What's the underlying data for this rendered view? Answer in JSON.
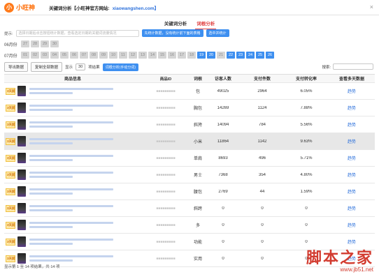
{
  "topbar": {
    "logo_text": "小旺神",
    "logo_glyph": "小",
    "title": "关键词分析【小旺神官方网站:",
    "url": "xiaowangshen.com】",
    "close": "×"
  },
  "tabs": [
    {
      "label": "关键词分析",
      "active": false
    },
    {
      "label": "词根分析",
      "active": true
    }
  ],
  "tip": {
    "label": "提示:",
    "text": "选择日期后点击按钮统计数据，查看选定日期的关键词流量情况",
    "buttons": [
      "先统计数据，没有统计前下面的表格",
      "选中并统计"
    ]
  },
  "months": [
    {
      "label": "06月份",
      "days": [
        "27",
        "28",
        "29",
        "30"
      ],
      "selected": []
    },
    {
      "label": "07月份",
      "days": [
        "01",
        "02",
        "03",
        "04",
        "05",
        "06",
        "07",
        "08",
        "09",
        "10",
        "11",
        "12",
        "13",
        "14",
        "15",
        "16",
        "17",
        "18",
        "19",
        "20",
        "21",
        "22",
        "23",
        "24",
        "25",
        "26"
      ],
      "selected": [
        "19",
        "20",
        "22",
        "23",
        "24",
        "25",
        "26"
      ]
    }
  ],
  "toolbar": {
    "export": "导出数据",
    "copy_all": "复制全部数据",
    "show_label": "显示",
    "page_size": "30",
    "records_label": "项结果",
    "analyze": "词根分析(手动分词)",
    "search_label": "搜索:"
  },
  "table": {
    "headers": [
      "商品信息",
      "商品ID",
      "词根",
      "访客人数",
      "支付件数",
      "支付转化率",
      "查看多天数据"
    ],
    "rows": [
      {
        "badge": "3天前",
        "word": "包",
        "visitors": "49025",
        "pay": "2964",
        "rate": "6.05%",
        "link": "趋势"
      },
      {
        "badge": "3天前",
        "word": "胸包",
        "visitors": "14269",
        "pay": "1124",
        "rate": "7.88%",
        "link": "趋势"
      },
      {
        "badge": "3天前",
        "word": "斜挎",
        "visitors": "14094",
        "pay": "784",
        "rate": "5.56%",
        "link": "趋势"
      },
      {
        "badge": "3天前",
        "word": "小米",
        "visitors": "11864",
        "pay": "1142",
        "rate": "9.63%",
        "link": "趋势"
      },
      {
        "badge": "3天前",
        "word": "单肩",
        "visitors": "8693",
        "pay": "496",
        "rate": "5.71%",
        "link": "趋势"
      },
      {
        "badge": "3天前",
        "word": "男士",
        "visitors": "7368",
        "pay": "354",
        "rate": "4.80%",
        "link": "趋势"
      },
      {
        "badge": "3天前",
        "word": "腰包",
        "visitors": "2769",
        "pay": "44",
        "rate": "1.59%",
        "link": "趋势"
      },
      {
        "badge": "3天前",
        "word": "斜跨",
        "visitors": "0",
        "pay": "0",
        "rate": "0",
        "link": "趋势"
      },
      {
        "badge": "3天前",
        "word": "多",
        "visitors": "0",
        "pay": "0",
        "rate": "0",
        "link": "趋势"
      },
      {
        "badge": "3天前",
        "word": "功能",
        "visitors": "0",
        "pay": "0",
        "rate": "0",
        "link": "趋势"
      },
      {
        "badge": "3天前",
        "word": "实用",
        "visitors": "0",
        "pay": "0",
        "rate": "0",
        "link": "趋势"
      }
    ]
  },
  "footer": "显示第 1 至 14 项结果，共 14 项",
  "watermark": {
    "cn": "脚本之家",
    "url": "www.jb51.net"
  }
}
